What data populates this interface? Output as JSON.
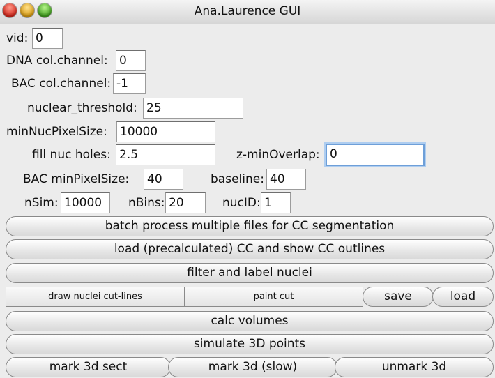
{
  "window": {
    "title": "Ana.Laurence GUI",
    "traffic_lights": {
      "close": "#d4281c",
      "minimize": "#d69a12",
      "zoom": "#3f9e1e"
    }
  },
  "fields": {
    "vid": {
      "label": "vid:",
      "value": "0"
    },
    "dna_channel": {
      "label": "DNA col.channel:",
      "value": "0"
    },
    "bac_channel": {
      "label": "BAC col.channel:",
      "value": "-1"
    },
    "nuclear_threshold": {
      "label": "nuclear_threshold:",
      "value": "25"
    },
    "min_nuc_pixel_size": {
      "label": "minNucPixelSize:",
      "value": "10000"
    },
    "fill_nuc_holes": {
      "label": "fill nuc holes:",
      "value": "2.5"
    },
    "z_min_overlap": {
      "label": "z-minOverlap:",
      "value": "0"
    },
    "bac_min_pixel_size": {
      "label": "BAC minPixelSize:",
      "value": "40"
    },
    "baseline": {
      "label": "baseline:",
      "value": "40"
    },
    "nsim": {
      "label": "nSim:",
      "value": "10000"
    },
    "nbins": {
      "label": "nBins:",
      "value": "20"
    },
    "nucid": {
      "label": "nucID:",
      "value": "1"
    }
  },
  "buttons": {
    "batch_process": "batch process multiple files for CC segmentation",
    "load_cc": "load (precalculated) CC and show CC outlines",
    "filter_label": "filter and label nuclei",
    "draw_cut_lines": "draw nuclei cut-lines",
    "paint_cut": "paint cut",
    "save": "save",
    "load": "load",
    "calc_volumes": "calc volumes",
    "simulate_3d": "simulate 3D points",
    "mark_3d_sect": "mark 3d sect",
    "mark_3d_slow": "mark 3d (slow)",
    "unmark_3d": "unmark 3d"
  },
  "colors": {
    "focus_ring": "#6e9fd8",
    "window_bg": "#ececec"
  }
}
